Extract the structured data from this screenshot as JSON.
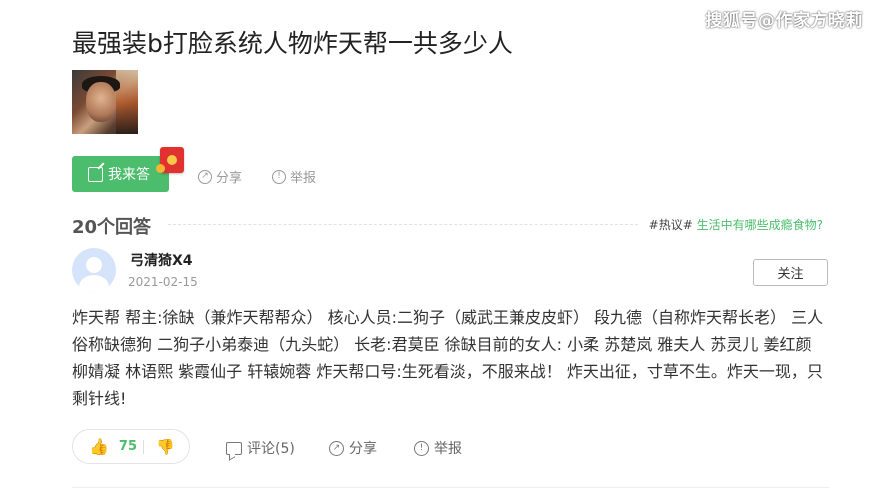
{
  "watermark": "搜狐号@作家方晓莉",
  "question": {
    "title": "最强装b打脸系统人物炸天帮一共多少人",
    "answer_button": "我来答",
    "share": "分享",
    "report": "举报"
  },
  "answers": {
    "count": "20个回答",
    "hot_prefix": "#热议#",
    "hot_topic": "生活中有哪些成瘾食物?"
  },
  "answer": {
    "username": "弓清猗X4",
    "date": "2021-02-15",
    "follow": "关注",
    "text": "炸天帮 帮主:徐缺（兼炸天帮帮众） 核心人员:二狗子（威武王兼皮皮虾） 段九德（自称炸天帮长老） 三人俗称缺德狗 二狗子小弟泰迪（九头蛇） 长老:君莫臣 徐缺目前的女人: 小柔 苏楚岚 雅夫人 苏灵儿 姜红颜 柳婧凝 林语熙 紫霞仙子 轩辕婉蓉 炸天帮口号:生死看淡，不服来战！ 炸天出征，寸草不生。炸天一现，只剩针线!",
    "likes": "75",
    "comments": "评论(5)",
    "share": "分享",
    "report": "举报"
  },
  "colors": {
    "accent": "#4cbd6c",
    "redpacket": "#e2322f"
  }
}
